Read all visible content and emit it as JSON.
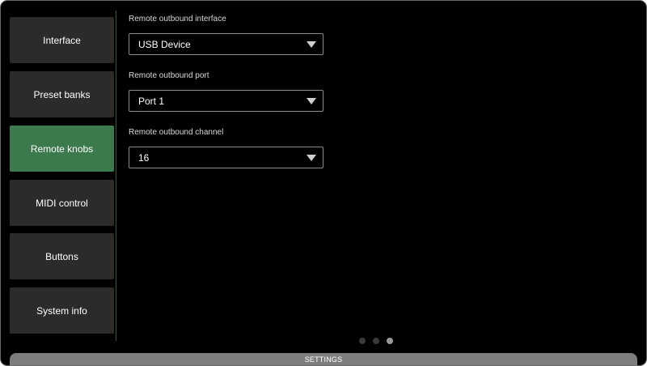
{
  "sidebar": {
    "items": [
      {
        "label": "Interface",
        "active": false
      },
      {
        "label": "Preset banks",
        "active": false
      },
      {
        "label": "Remote knobs",
        "active": true
      },
      {
        "label": "MIDI control",
        "active": false
      },
      {
        "label": "Buttons",
        "active": false
      },
      {
        "label": "System info",
        "active": false
      }
    ]
  },
  "settings": {
    "outbound_interface": {
      "label": "Remote outbound interface",
      "value": "USB Device"
    },
    "outbound_port": {
      "label": "Remote outbound port",
      "value": "Port 1"
    },
    "outbound_channel": {
      "label": "Remote outbound channel",
      "value": "16"
    }
  },
  "pagination": {
    "total": 3,
    "current": 3
  },
  "footer": {
    "title": "SETTINGS"
  },
  "colors": {
    "accent_active": "#3a7a4c",
    "nav_bg": "#2b2b2b",
    "screen_bg": "#000000"
  }
}
